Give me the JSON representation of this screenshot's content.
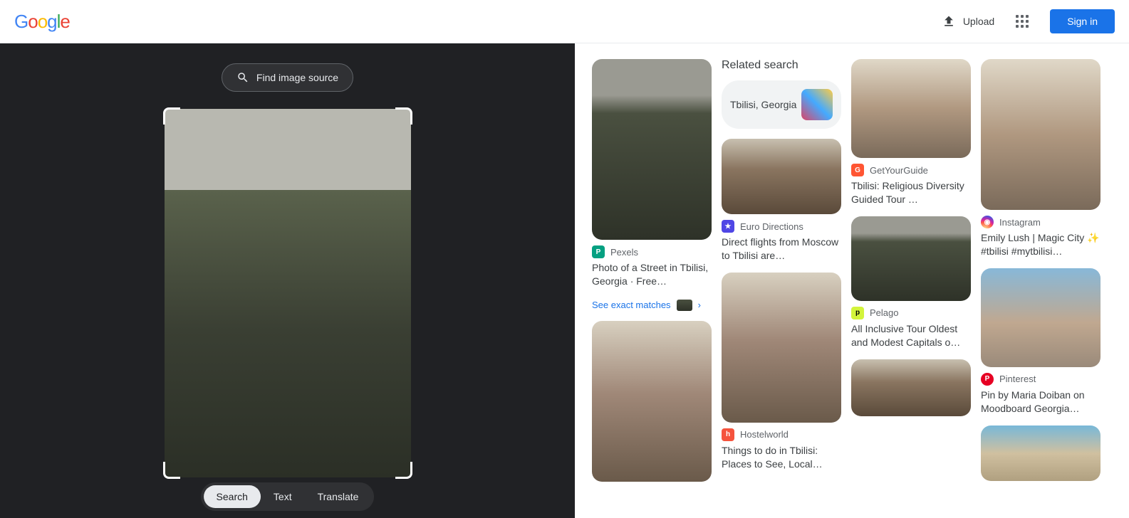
{
  "header": {
    "upload_label": "Upload",
    "signin_label": "Sign in"
  },
  "left": {
    "find_source": "Find image source",
    "modes": {
      "search": "Search",
      "text": "Text",
      "translate": "Translate"
    }
  },
  "related": {
    "heading": "Related search",
    "chip": "Tbilisi, Georgia"
  },
  "exact_matches": "See exact matches",
  "results": {
    "c1r1": {
      "source": "Pexels",
      "title": "Photo of a Street in Tbilisi, Georgia · Free…"
    },
    "c2r1": {
      "source": "Euro Directions",
      "title": "Direct flights from Moscow to Tbilisi are…"
    },
    "c2r2": {
      "source": "Hostelworld",
      "title": "Things to do in Tbilisi: Places to See, Local…"
    },
    "c3r1": {
      "source": "GetYourGuide",
      "title": "Tbilisi: Religious Diversity Guided Tour …"
    },
    "c3r2": {
      "source": "Pelago",
      "title": "All Inclusive Tour Oldest and Modest Capitals o…"
    },
    "c4r1": {
      "source": "Instagram",
      "title": "Emily Lush | Magic City ✨ #tbilisi #mytbilisi…"
    },
    "c4r2": {
      "source": "Pinterest",
      "title": "Pin by Maria Doiban on Moodboard Georgia…"
    }
  },
  "colors": {
    "pexels": "#05a081",
    "eurodir": "#4f46e5",
    "hostelw": "#f5533d",
    "gyg": "#ff5533",
    "pelago": "#d3f43b",
    "instagram": "#e1306c",
    "pinterest": "#e60023"
  }
}
